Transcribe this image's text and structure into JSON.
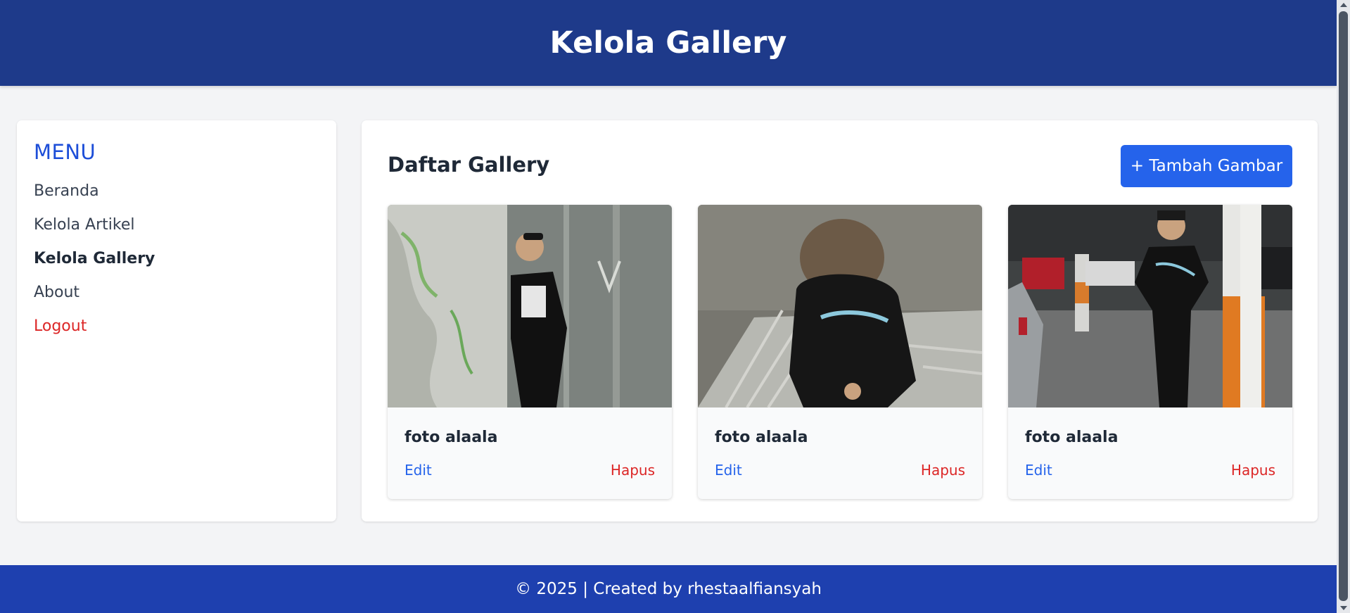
{
  "header": {
    "title": "Kelola Gallery"
  },
  "sidebar": {
    "title": "MENU",
    "items": [
      {
        "label": "Beranda"
      },
      {
        "label": "Kelola Artikel"
      },
      {
        "label": "Kelola Gallery"
      },
      {
        "label": "About"
      },
      {
        "label": "Logout"
      }
    ]
  },
  "main": {
    "title": "Daftar Gallery",
    "add_button": "+ Tambah Gambar",
    "cards": [
      {
        "title": "foto alaala",
        "edit": "Edit",
        "delete": "Hapus"
      },
      {
        "title": "foto alaala",
        "edit": "Edit",
        "delete": "Hapus"
      },
      {
        "title": "foto alaala",
        "edit": "Edit",
        "delete": "Hapus"
      }
    ]
  },
  "footer": {
    "text": "© 2025 | Created by rhestaalfiansyah"
  },
  "colors": {
    "header_bg": "#1e3a8a",
    "footer_bg": "#1e40af",
    "accent": "#2563eb",
    "danger": "#dc2626"
  }
}
